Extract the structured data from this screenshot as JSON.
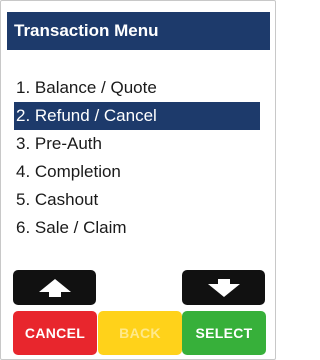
{
  "header": {
    "title": "Transaction Menu"
  },
  "menu": {
    "items": [
      {
        "label": "1. Balance / Quote"
      },
      {
        "label": "2. Refund / Cancel"
      },
      {
        "label": "3. Pre-Auth"
      },
      {
        "label": "4. Completion"
      },
      {
        "label": "5. Cashout"
      },
      {
        "label": "6. Sale / Claim"
      }
    ],
    "selected_index": 1
  },
  "keys": {
    "up_icon": "up-arrow-icon",
    "down_icon": "down-arrow-icon",
    "cancel_label": "CANCEL",
    "back_label": "BACK",
    "select_label": "SELECT"
  },
  "colors": {
    "header_bg": "#1d3a6b",
    "highlight_bg": "#1d3a6b",
    "cancel": "#e8262d",
    "back": "#ffd21a",
    "select": "#37b03a"
  }
}
